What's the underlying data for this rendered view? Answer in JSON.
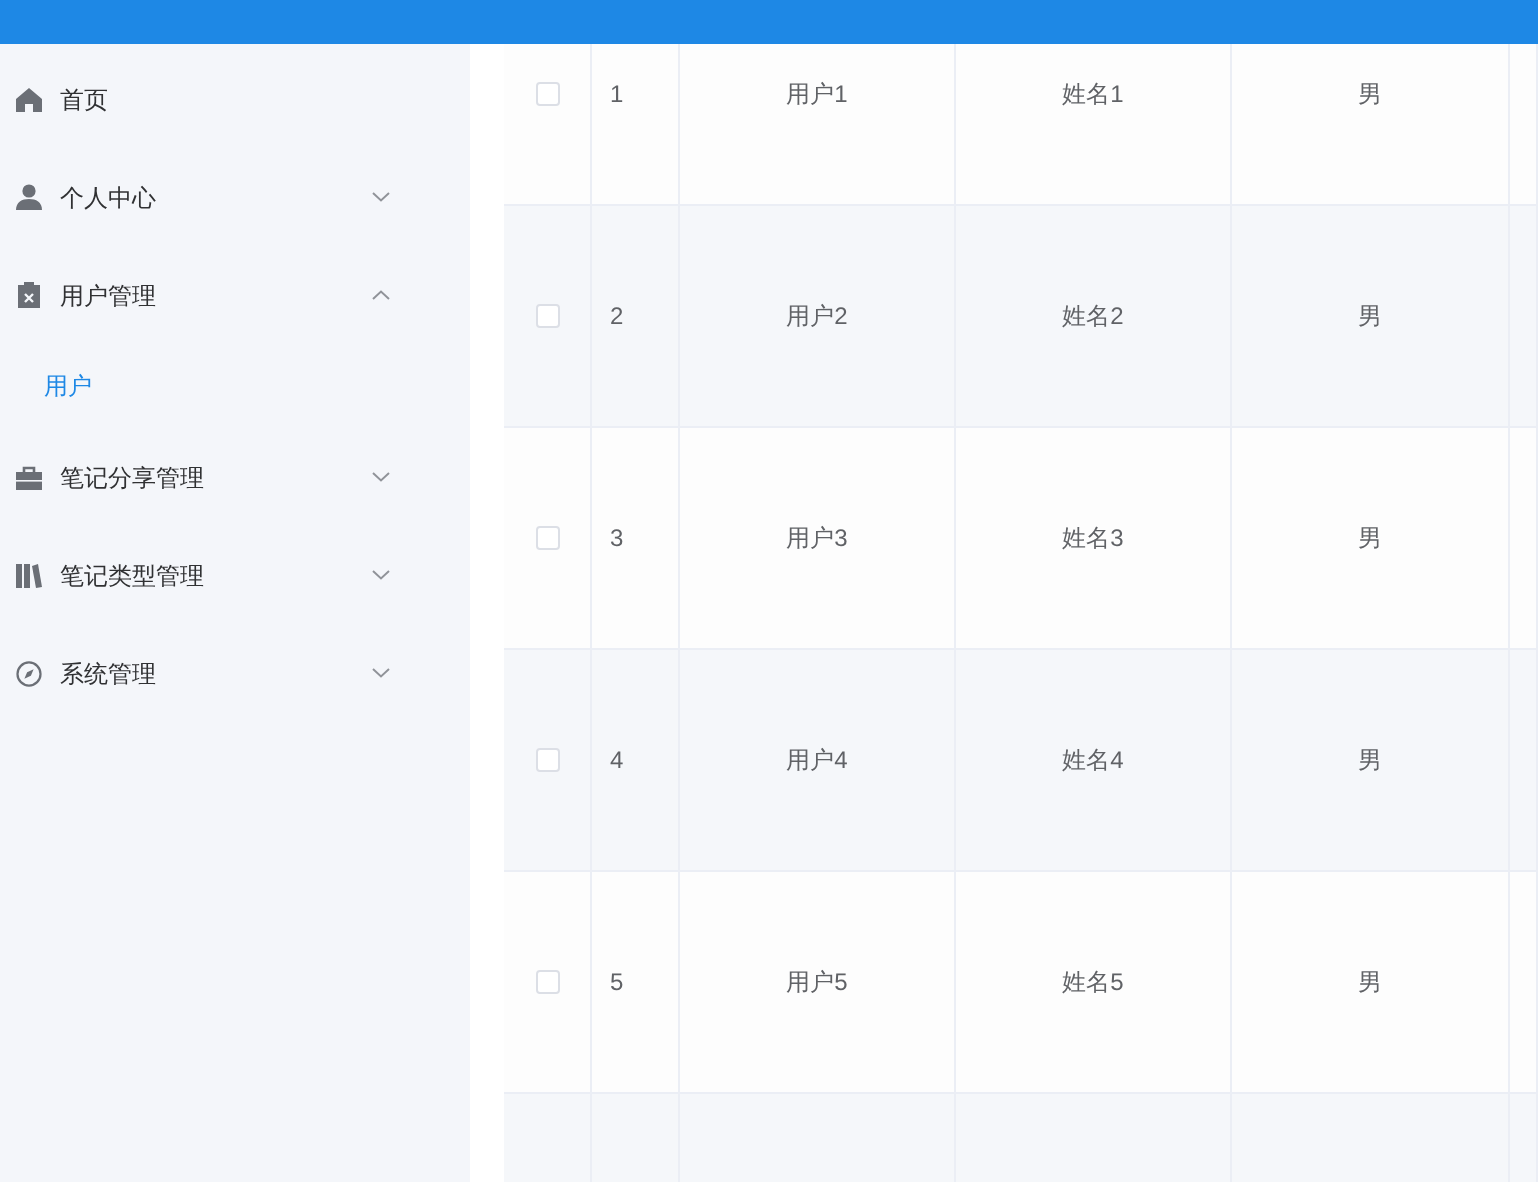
{
  "sidebar": {
    "items": [
      {
        "kind": "link",
        "label": "首页",
        "selected": false
      },
      {
        "kind": "submenu",
        "label": "个人中心",
        "expanded": false,
        "selected": false
      },
      {
        "kind": "submenu",
        "label": "用户管理",
        "expanded": true,
        "selected": false,
        "children": [
          {
            "label": "用户",
            "selected": true
          }
        ]
      },
      {
        "kind": "submenu",
        "label": "笔记分享管理",
        "expanded": false,
        "selected": false
      },
      {
        "kind": "submenu",
        "label": "笔记类型管理",
        "expanded": false,
        "selected": false
      },
      {
        "kind": "submenu",
        "label": "系统管理",
        "expanded": false,
        "selected": false
      }
    ]
  },
  "table": {
    "rows": [
      {
        "checked": false,
        "index": "1",
        "username": "用户1",
        "name": "姓名1",
        "gender": "男"
      },
      {
        "checked": false,
        "index": "2",
        "username": "用户2",
        "name": "姓名2",
        "gender": "男"
      },
      {
        "checked": false,
        "index": "3",
        "username": "用户3",
        "name": "姓名3",
        "gender": "男"
      },
      {
        "checked": false,
        "index": "4",
        "username": "用户4",
        "name": "姓名4",
        "gender": "男"
      },
      {
        "checked": false,
        "index": "5",
        "username": "用户5",
        "name": "姓名5",
        "gender": "男"
      }
    ]
  }
}
